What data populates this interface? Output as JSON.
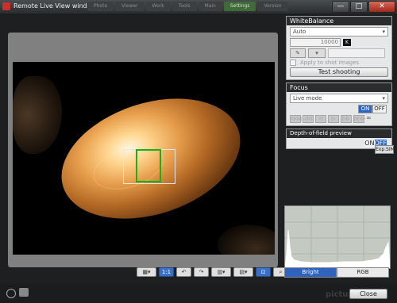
{
  "window": {
    "title": "Remote Live View window",
    "background_tabs": [
      "Photo",
      "Viewer",
      "Work",
      "Tools",
      "Main",
      "Settings",
      "Version"
    ],
    "controls": {
      "minimize": "—",
      "maximize": "□",
      "close": "✕"
    }
  },
  "toolbar": {
    "buttons": [
      {
        "name": "overlay-button",
        "glyph": "▦▾"
      },
      {
        "name": "ratio-button",
        "glyph": "1:1"
      },
      {
        "name": "rotate-left-button",
        "glyph": "↶"
      },
      {
        "name": "rotate-right-button",
        "glyph": "↷"
      },
      {
        "name": "grid-button",
        "glyph": "▥▾"
      },
      {
        "name": "display-button",
        "glyph": "▤▾"
      },
      {
        "name": "zoom-fit-button",
        "glyph": "⊡"
      },
      {
        "name": "magnify-button",
        "glyph": "⌕"
      }
    ]
  },
  "white_balance": {
    "title": "WhiteBalance",
    "mode": "Auto",
    "kelvin_value": "10000",
    "kelvin_button": "K",
    "dropper_glyph": "✎",
    "apply_label": "Apply to shot images",
    "test_shooting_label": "Test shooting"
  },
  "focus": {
    "title": "Focus",
    "mode": "Live mode",
    "on_label": "ON",
    "off_label": "OFF",
    "step_buttons": [
      "◁◁◁",
      "◁◁",
      "◁",
      "▷",
      "▷▷",
      "▷▷▷"
    ],
    "infinity": "∞"
  },
  "depth_of_field": {
    "title": "Depth-of-field preview",
    "on_label": "ON",
    "off_label": "OFF",
    "exp_sim_label": "Exp.SIM"
  },
  "histogram": {
    "tabs": [
      "Bright",
      "RGB"
    ],
    "active_tab": "Bright"
  },
  "footer": {
    "close_label": "Close",
    "watermark": "pictures"
  },
  "colors": {
    "accent": "#2c67c8",
    "af_frame_green": "#19b019"
  }
}
